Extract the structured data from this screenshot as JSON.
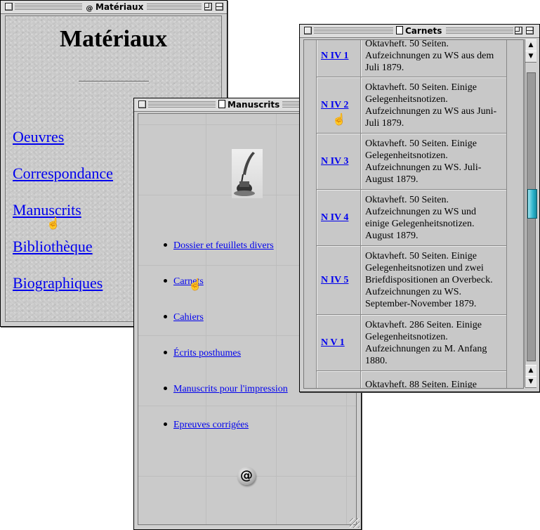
{
  "windows": {
    "materiaux": {
      "title": "Matériaux",
      "heading": "Matériaux",
      "links": [
        "Oeuvres",
        "Correspondance",
        "Manuscrits",
        "Bibliothèque",
        "Biographiques"
      ]
    },
    "manuscrits": {
      "title": "Manuscrits",
      "items": [
        "Dossier et feuillets divers",
        "Carnets",
        "Cahiers",
        "Écrits posthumes",
        "Manuscrits pour l'impression",
        "Epreuves corrigées"
      ],
      "at_symbol": "@"
    },
    "carnets": {
      "title": "Carnets",
      "rows": [
        {
          "code": "N IV 1",
          "desc": "Oktavheft. 50 Seiten. Aufzeichnungen zu WS aus dem Juli 1879."
        },
        {
          "code": "N IV 2",
          "desc": "Oktavheft. 50 Seiten. Einige Gelegenheitsnotizen. Aufzeichnungen zu WS aus Juni-Juli 1879."
        },
        {
          "code": "N IV 3",
          "desc": "Oktavheft. 50 Seiten. Einige Gelegenheitsnotizen. Aufzeichnungen zu WS. Juli-August 1879."
        },
        {
          "code": "N IV 4",
          "desc": "Oktavheft. 50 Seiten. Aufzeichnungen zu WS und einige Gelegenheitsnotizen. August 1879."
        },
        {
          "code": "N IV 5",
          "desc": "Oktavheft. 50 Seiten. Einige Gelegenheitsnotizen und zwei Briefdispositionen an Overbeck. Aufzeichnungen zu WS. September-November 1879."
        },
        {
          "code": "N V 1",
          "desc": "Oktavheft. 286 Seiten. Einige Gelegenheitsnotizen. Aufzeichnungen zu M. Anfang 1880."
        },
        {
          "code": "",
          "desc": "Oktavheft. 88 Seiten. Einige"
        }
      ],
      "scroll_position": 0.45
    }
  },
  "icons": {
    "pointer": "pointing-hand-cursor",
    "materiaux_title_icon": "at-sign-icon",
    "manuscrits_title_icon": "document-icon",
    "carnets_title_icon": "notebook-icon"
  },
  "colors": {
    "link": "#0000ee",
    "scroll_thumb": "#2bb3cb"
  }
}
